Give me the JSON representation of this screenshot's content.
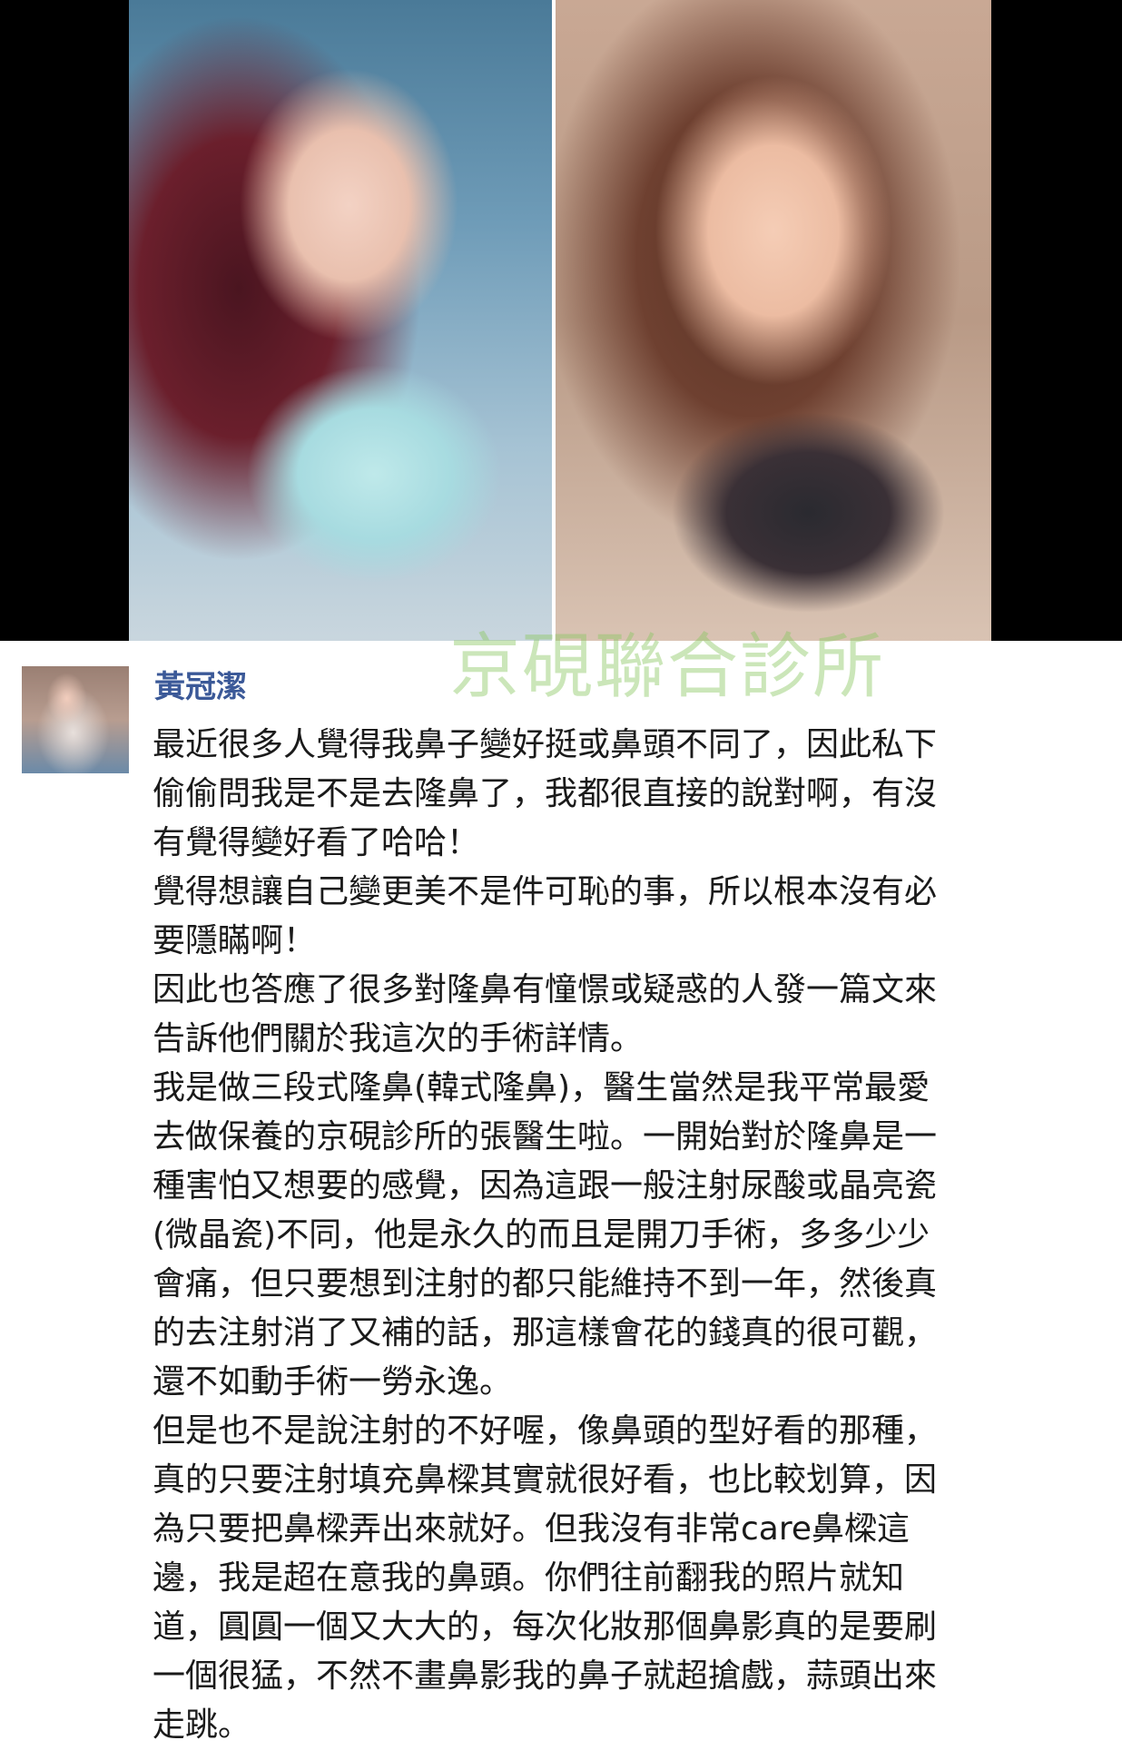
{
  "photos": {
    "left_alt": "selfie-at-beach",
    "right_alt": "selfie-indoors"
  },
  "post": {
    "author": "黃冠潔",
    "watermark": "京硯聯合診所",
    "lines": [
      "最近很多人覺得我鼻子變好挺或鼻頭不同了，因此私下",
      "偷偷問我是不是去隆鼻了，我都很直接的說對啊，有沒",
      "有覺得變好看了哈哈！",
      "覺得想讓自己變更美不是件可恥的事，所以根本沒有必",
      "要隱瞞啊！",
      "因此也答應了很多對隆鼻有憧憬或疑惑的人發一篇文來",
      "告訴他們關於我這次的手術詳情。",
      "我是做三段式隆鼻(韓式隆鼻)，醫生當然是我平常最愛",
      "去做保養的京硯診所的張醫生啦。一開始對於隆鼻是一",
      "種害怕又想要的感覺，因為這跟一般注射尿酸或晶亮瓷",
      "(微晶瓷)不同，他是永久的而且是開刀手術，多多少少",
      "會痛，但只要想到注射的都只能維持不到一年，然後真",
      "的去注射消了又補的話，那這樣會花的錢真的很可觀，",
      "還不如動手術一勞永逸。",
      "但是也不是說注射的不好喔，像鼻頭的型好看的那種，",
      "真的只要注射填充鼻樑其實就很好看，也比較划算，因",
      "為只要把鼻樑弄出來就好。但我沒有非常care鼻樑這",
      "邊，我是超在意我的鼻頭。你們往前翻我的照片就知",
      "道，圓圓一個又大大的，每次化妝那個鼻影真的是要刷",
      "一個很猛，不然不畫鼻影我的鼻子就超搶戲，蒜頭出來",
      "走跳。"
    ]
  }
}
